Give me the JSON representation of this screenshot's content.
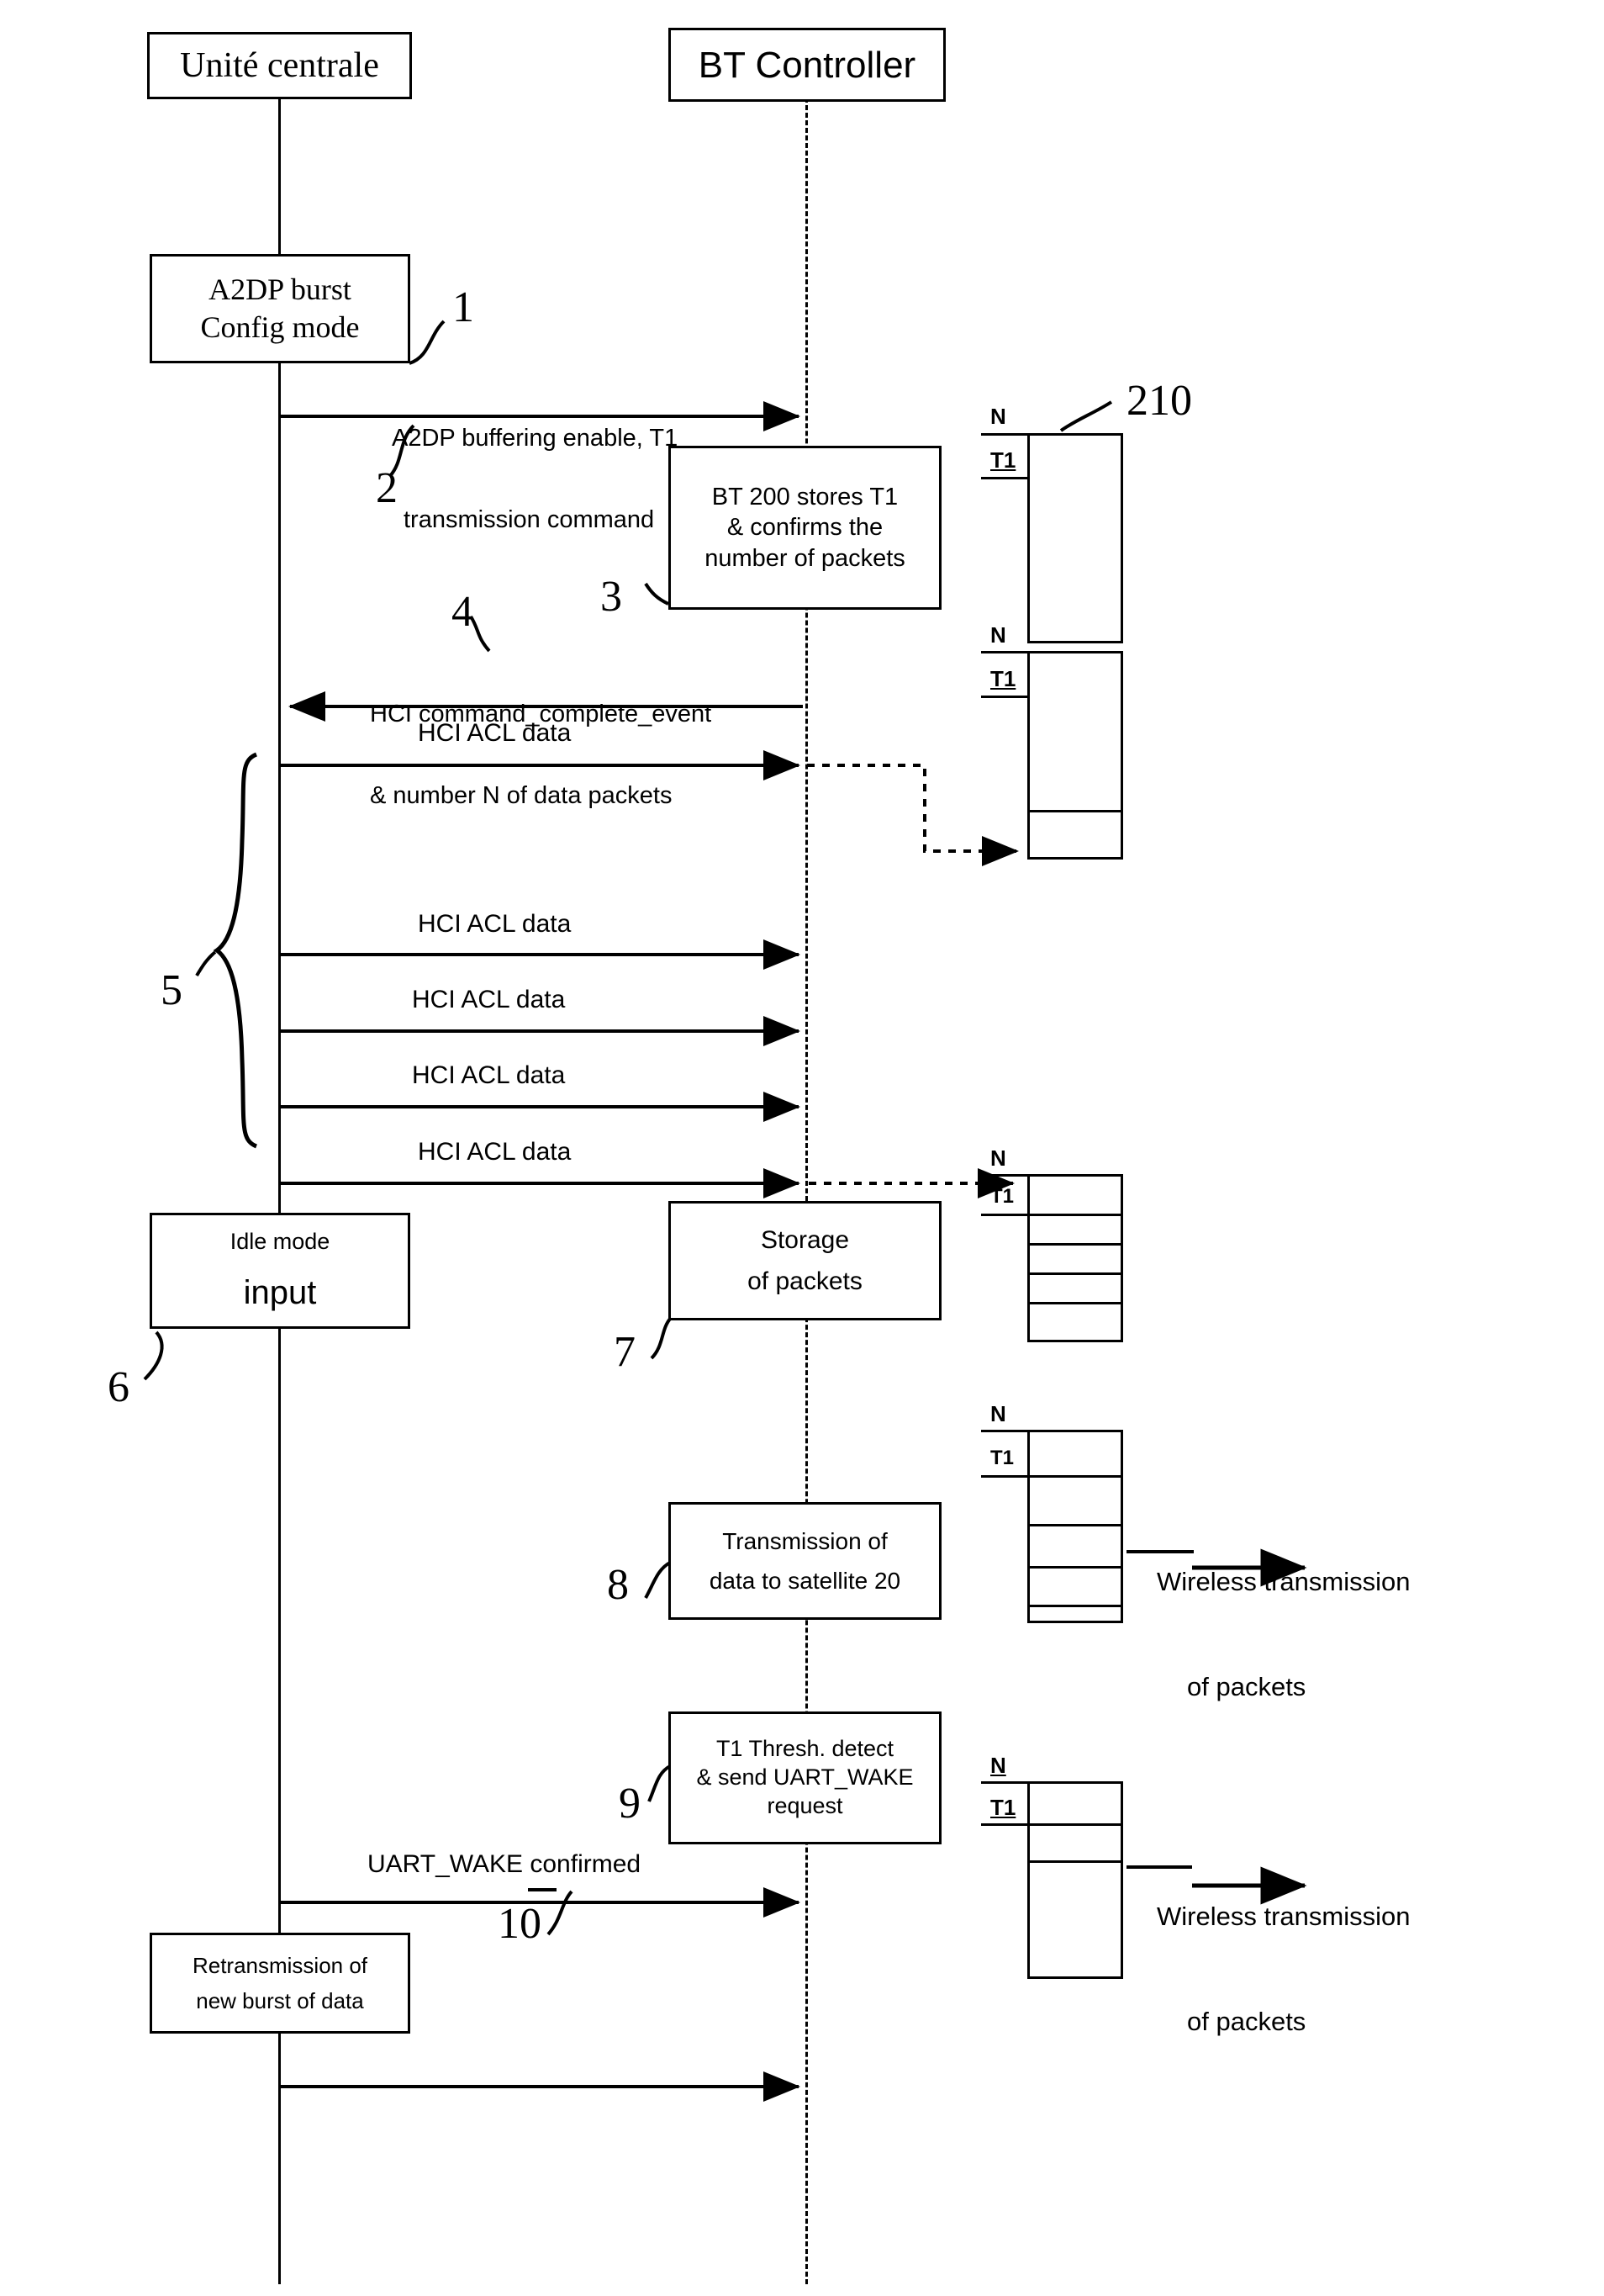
{
  "diagram": {
    "title_actors": {
      "central_unit": "Unité centrale",
      "bt_controller": "BT Controller"
    },
    "process_boxes": [
      {
        "id": "a2dp-config",
        "lines": [
          "A2DP burst",
          "Config mode"
        ]
      },
      {
        "id": "bt-stores",
        "lines": [
          "BT 200 stores T1",
          "& confirms the",
          "number of packets"
        ]
      },
      {
        "id": "idle-mode",
        "lines": [
          "Idle mode",
          "input"
        ]
      },
      {
        "id": "storage",
        "lines": [
          "Storage",
          "of packets"
        ]
      },
      {
        "id": "transmission",
        "lines": [
          "Transmission of",
          "data to satellite 20"
        ]
      },
      {
        "id": "threshold",
        "lines": [
          "T1 Thresh. detect",
          "& send UART_WAKE",
          "request"
        ]
      },
      {
        "id": "retransmission",
        "lines": [
          "Retransmission of",
          "new burst of data"
        ]
      }
    ],
    "messages": [
      {
        "id": "m1",
        "lines": [
          "A2DP buffering enable, T1",
          "transmission command"
        ],
        "direction": "right"
      },
      {
        "id": "m2",
        "lines": [
          "HCI command_complete_event",
          "& number N of data packets"
        ],
        "direction": "left"
      },
      {
        "id": "m3",
        "lines": [
          "HCI ACL data"
        ],
        "direction": "right"
      },
      {
        "id": "m4",
        "lines": [
          "HCI ACL data"
        ],
        "direction": "right"
      },
      {
        "id": "m5",
        "lines": [
          "HCI ACL data"
        ],
        "direction": "right"
      },
      {
        "id": "m6",
        "lines": [
          "HCI ACL data"
        ],
        "direction": "right"
      },
      {
        "id": "m7",
        "lines": [
          "HCI ACL data"
        ],
        "direction": "right"
      },
      {
        "id": "m8",
        "lines": [
          "UART_WAKE confirmed"
        ],
        "direction": "right"
      }
    ],
    "reference_numbers": [
      "1",
      "2",
      "3",
      "4",
      "5",
      "6",
      "7",
      "8",
      "9",
      "10",
      "210"
    ],
    "buffer_labels": {
      "top": "N",
      "threshold": "T1"
    },
    "annotations": [
      {
        "id": "wireless-1",
        "lines": [
          "Wireless transmission",
          "of packets"
        ]
      },
      {
        "id": "wireless-2",
        "lines": [
          "Wireless transmission",
          "of packets"
        ]
      }
    ],
    "colors": {
      "ink": "#000000",
      "paper": "#ffffff"
    }
  }
}
